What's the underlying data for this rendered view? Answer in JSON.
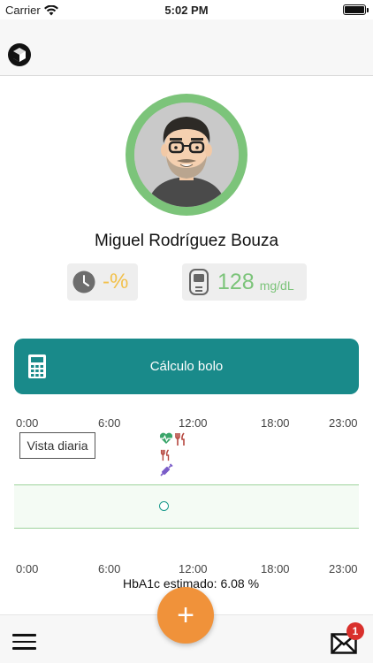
{
  "status_bar": {
    "carrier": "Carrier",
    "time": "5:02 PM"
  },
  "profile": {
    "name": "Miguel Rodríguez Bouza"
  },
  "metrics": {
    "time_in_range": "-%",
    "glucose_value": "128",
    "glucose_unit": "mg/dL"
  },
  "bolus": {
    "label": "Cálculo bolo"
  },
  "timeline": {
    "top_labels": [
      "0:00",
      "6:00",
      "12:00",
      "18:00",
      "23:00"
    ],
    "bottom_labels": [
      "0:00",
      "6:00",
      "12:00",
      "18:00",
      "23:00"
    ],
    "view_button": "Vista diaria",
    "event_icons": [
      "heart-rate-icon",
      "meal-icon",
      "meal-icon",
      "insulin-syringe-icon"
    ]
  },
  "summary": {
    "hba1c": "HbA1c estimado: 6.08 %"
  },
  "bottom_bar": {
    "badge_count": "1",
    "add_label": "+"
  },
  "colors": {
    "primary_teal": "#198a8a",
    "avatar_ring": "#7cc47a",
    "percent_yellow": "#f2c04a",
    "glucose_green": "#7cc47a",
    "fab_orange": "#f0923a",
    "badge_red": "#d9302c",
    "meal_red": "#b5473f",
    "insulin_purple": "#7a5cc8"
  }
}
